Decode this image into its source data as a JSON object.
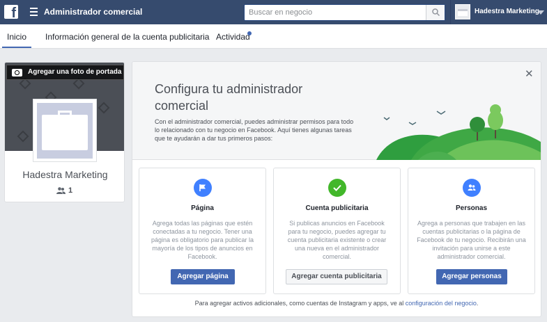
{
  "topbar": {
    "logo": "f",
    "app_title": "Administrador comercial",
    "search_placeholder": "Buscar en negocio",
    "account_name": "Hadestra Marketing"
  },
  "tabs": [
    {
      "label": "Inicio",
      "active": true
    },
    {
      "label": "Información general de la cuenta publicitaria",
      "active": false
    },
    {
      "label": "Actividad",
      "active": false,
      "has_notification": true
    }
  ],
  "profile": {
    "cover_button_label": "Agregar una foto de portada",
    "business_name": "Hadestra Marketing",
    "member_count": "1"
  },
  "setup": {
    "heading": "Configura tu administrador comercial",
    "intro": "Con el administrador comercial, puedes administrar permisos para todo lo relacionado con tu negocio en Facebook. Aquí tienes algunas tareas que te ayudarán a dar tus primeros pasos:",
    "tiles": [
      {
        "icon": "flag-icon",
        "color": "#4080ff",
        "title": "Página",
        "description": "Agrega todas las páginas que estén conectadas a tu negocio. Tener una página es obligatorio para publicar la mayoría de los tipos de anuncios en Facebook.",
        "button": "Agregar página",
        "button_style": "primary"
      },
      {
        "icon": "check-icon",
        "color": "#42b72a",
        "title": "Cuenta publicitaria",
        "description": "Si publicas anuncios en Facebook para tu negocio, puedes agregar tu cuenta publicitaria existente o crear una nueva en el administrador comercial.",
        "button": "Agregar cuenta publicitaria",
        "button_style": "secondary"
      },
      {
        "icon": "people-icon",
        "color": "#4080ff",
        "title": "Personas",
        "description": "Agrega a personas que trabajen en las cuentas publicitarias o la página de Facebook de tu negocio. Recibirán una invitación para unirse a este administrador comercial.",
        "button": "Agregar personas",
        "button_style": "primary"
      }
    ],
    "footer_text": "Para agregar activos adicionales, como cuentas de Instagram y apps, ve al ",
    "footer_link": "configuración del negocio",
    "footer_end": "."
  }
}
